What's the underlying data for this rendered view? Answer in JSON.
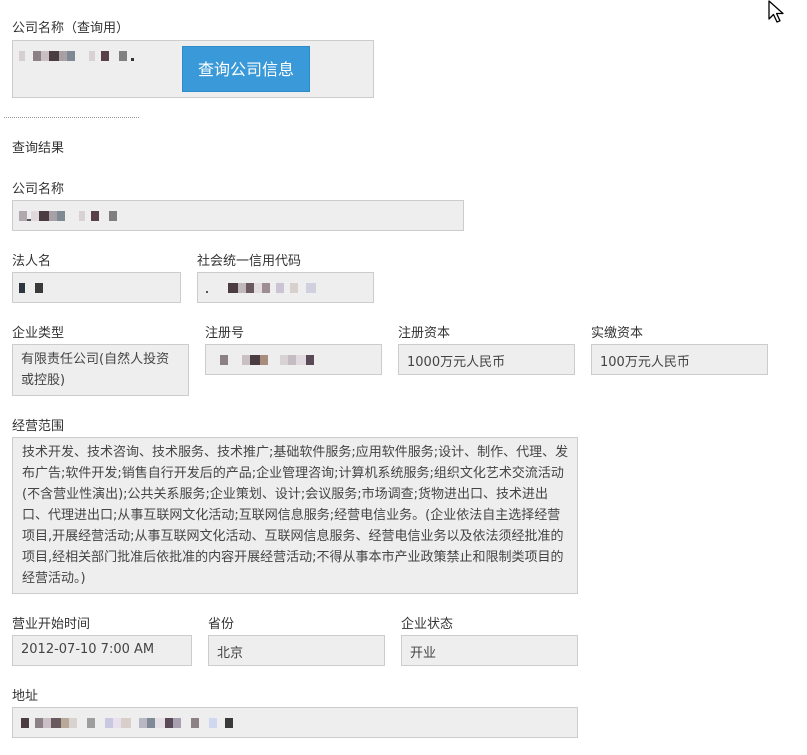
{
  "query": {
    "label": "公司名称（查询用）",
    "button_label": "查询公司信息"
  },
  "results": {
    "section_title": "查询结果",
    "company_name_label": "公司名称",
    "legal_person_label": "法人名",
    "credit_code_label": "社会统一信用代码",
    "company_type_label": "企业类型",
    "company_type_value": "有限责任公司(自然人投资或控股)",
    "reg_no_label": "注册号",
    "reg_capital_label": "注册资本",
    "reg_capital_value": "1000万元人民币",
    "paid_capital_label": "实缴资本",
    "paid_capital_value": "100万元人民币",
    "scope_label": "经营范围",
    "scope_value": "技术开发、技术咨询、技术服务、技术推广;基础软件服务;应用软件服务;设计、制作、代理、发布广告;软件开发;销售自行开发后的产品;企业管理咨询;计算机系统服务;组织文化艺术交流活动(不含营业性演出);公共关系服务;企业策划、设计;会议服务;市场调查;货物进出口、技术进出口、代理进出口;从事互联网文化活动;互联网信息服务;经营电信业务。(企业依法自主选择经营项目,开展经营活动;从事互联网文化活动、互联网信息服务、经营电信业务以及依法须经批准的项目,经相关部门批准后依批准的内容开展经营活动;不得从事本市产业政策禁止和限制类项目的经营活动。)",
    "start_time_label": "营业开始时间",
    "start_time_value": "2012-07-10 7:00 AM",
    "province_label": "省份",
    "province_value": "北京",
    "status_label": "企业状态",
    "status_value": "开业",
    "address_label": "地址"
  },
  "icons": {
    "cursor": "mouse-pointer-icon"
  },
  "colors": {
    "button": "#3a9ad9",
    "field_bg": "#eeeeee",
    "field_border": "#cccccc"
  }
}
